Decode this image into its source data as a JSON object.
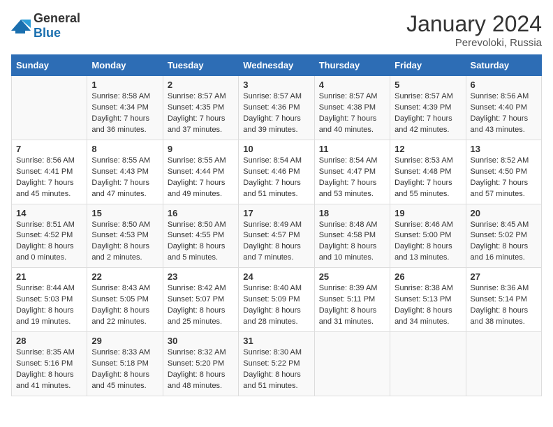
{
  "header": {
    "logo_general": "General",
    "logo_blue": "Blue",
    "title": "January 2024",
    "subtitle": "Perevoloki, Russia"
  },
  "columns": [
    "Sunday",
    "Monday",
    "Tuesday",
    "Wednesday",
    "Thursday",
    "Friday",
    "Saturday"
  ],
  "weeks": [
    [
      {
        "day": "",
        "sunrise": "",
        "sunset": "",
        "daylight": ""
      },
      {
        "day": "1",
        "sunrise": "Sunrise: 8:58 AM",
        "sunset": "Sunset: 4:34 PM",
        "daylight": "Daylight: 7 hours and 36 minutes."
      },
      {
        "day": "2",
        "sunrise": "Sunrise: 8:57 AM",
        "sunset": "Sunset: 4:35 PM",
        "daylight": "Daylight: 7 hours and 37 minutes."
      },
      {
        "day": "3",
        "sunrise": "Sunrise: 8:57 AM",
        "sunset": "Sunset: 4:36 PM",
        "daylight": "Daylight: 7 hours and 39 minutes."
      },
      {
        "day": "4",
        "sunrise": "Sunrise: 8:57 AM",
        "sunset": "Sunset: 4:38 PM",
        "daylight": "Daylight: 7 hours and 40 minutes."
      },
      {
        "day": "5",
        "sunrise": "Sunrise: 8:57 AM",
        "sunset": "Sunset: 4:39 PM",
        "daylight": "Daylight: 7 hours and 42 minutes."
      },
      {
        "day": "6",
        "sunrise": "Sunrise: 8:56 AM",
        "sunset": "Sunset: 4:40 PM",
        "daylight": "Daylight: 7 hours and 43 minutes."
      }
    ],
    [
      {
        "day": "7",
        "sunrise": "Sunrise: 8:56 AM",
        "sunset": "Sunset: 4:41 PM",
        "daylight": "Daylight: 7 hours and 45 minutes."
      },
      {
        "day": "8",
        "sunrise": "Sunrise: 8:55 AM",
        "sunset": "Sunset: 4:43 PM",
        "daylight": "Daylight: 7 hours and 47 minutes."
      },
      {
        "day": "9",
        "sunrise": "Sunrise: 8:55 AM",
        "sunset": "Sunset: 4:44 PM",
        "daylight": "Daylight: 7 hours and 49 minutes."
      },
      {
        "day": "10",
        "sunrise": "Sunrise: 8:54 AM",
        "sunset": "Sunset: 4:46 PM",
        "daylight": "Daylight: 7 hours and 51 minutes."
      },
      {
        "day": "11",
        "sunrise": "Sunrise: 8:54 AM",
        "sunset": "Sunset: 4:47 PM",
        "daylight": "Daylight: 7 hours and 53 minutes."
      },
      {
        "day": "12",
        "sunrise": "Sunrise: 8:53 AM",
        "sunset": "Sunset: 4:48 PM",
        "daylight": "Daylight: 7 hours and 55 minutes."
      },
      {
        "day": "13",
        "sunrise": "Sunrise: 8:52 AM",
        "sunset": "Sunset: 4:50 PM",
        "daylight": "Daylight: 7 hours and 57 minutes."
      }
    ],
    [
      {
        "day": "14",
        "sunrise": "Sunrise: 8:51 AM",
        "sunset": "Sunset: 4:52 PM",
        "daylight": "Daylight: 8 hours and 0 minutes."
      },
      {
        "day": "15",
        "sunrise": "Sunrise: 8:50 AM",
        "sunset": "Sunset: 4:53 PM",
        "daylight": "Daylight: 8 hours and 2 minutes."
      },
      {
        "day": "16",
        "sunrise": "Sunrise: 8:50 AM",
        "sunset": "Sunset: 4:55 PM",
        "daylight": "Daylight: 8 hours and 5 minutes."
      },
      {
        "day": "17",
        "sunrise": "Sunrise: 8:49 AM",
        "sunset": "Sunset: 4:57 PM",
        "daylight": "Daylight: 8 hours and 7 minutes."
      },
      {
        "day": "18",
        "sunrise": "Sunrise: 8:48 AM",
        "sunset": "Sunset: 4:58 PM",
        "daylight": "Daylight: 8 hours and 10 minutes."
      },
      {
        "day": "19",
        "sunrise": "Sunrise: 8:46 AM",
        "sunset": "Sunset: 5:00 PM",
        "daylight": "Daylight: 8 hours and 13 minutes."
      },
      {
        "day": "20",
        "sunrise": "Sunrise: 8:45 AM",
        "sunset": "Sunset: 5:02 PM",
        "daylight": "Daylight: 8 hours and 16 minutes."
      }
    ],
    [
      {
        "day": "21",
        "sunrise": "Sunrise: 8:44 AM",
        "sunset": "Sunset: 5:03 PM",
        "daylight": "Daylight: 8 hours and 19 minutes."
      },
      {
        "day": "22",
        "sunrise": "Sunrise: 8:43 AM",
        "sunset": "Sunset: 5:05 PM",
        "daylight": "Daylight: 8 hours and 22 minutes."
      },
      {
        "day": "23",
        "sunrise": "Sunrise: 8:42 AM",
        "sunset": "Sunset: 5:07 PM",
        "daylight": "Daylight: 8 hours and 25 minutes."
      },
      {
        "day": "24",
        "sunrise": "Sunrise: 8:40 AM",
        "sunset": "Sunset: 5:09 PM",
        "daylight": "Daylight: 8 hours and 28 minutes."
      },
      {
        "day": "25",
        "sunrise": "Sunrise: 8:39 AM",
        "sunset": "Sunset: 5:11 PM",
        "daylight": "Daylight: 8 hours and 31 minutes."
      },
      {
        "day": "26",
        "sunrise": "Sunrise: 8:38 AM",
        "sunset": "Sunset: 5:13 PM",
        "daylight": "Daylight: 8 hours and 34 minutes."
      },
      {
        "day": "27",
        "sunrise": "Sunrise: 8:36 AM",
        "sunset": "Sunset: 5:14 PM",
        "daylight": "Daylight: 8 hours and 38 minutes."
      }
    ],
    [
      {
        "day": "28",
        "sunrise": "Sunrise: 8:35 AM",
        "sunset": "Sunset: 5:16 PM",
        "daylight": "Daylight: 8 hours and 41 minutes."
      },
      {
        "day": "29",
        "sunrise": "Sunrise: 8:33 AM",
        "sunset": "Sunset: 5:18 PM",
        "daylight": "Daylight: 8 hours and 45 minutes."
      },
      {
        "day": "30",
        "sunrise": "Sunrise: 8:32 AM",
        "sunset": "Sunset: 5:20 PM",
        "daylight": "Daylight: 8 hours and 48 minutes."
      },
      {
        "day": "31",
        "sunrise": "Sunrise: 8:30 AM",
        "sunset": "Sunset: 5:22 PM",
        "daylight": "Daylight: 8 hours and 51 minutes."
      },
      {
        "day": "",
        "sunrise": "",
        "sunset": "",
        "daylight": ""
      },
      {
        "day": "",
        "sunrise": "",
        "sunset": "",
        "daylight": ""
      },
      {
        "day": "",
        "sunrise": "",
        "sunset": "",
        "daylight": ""
      }
    ]
  ]
}
